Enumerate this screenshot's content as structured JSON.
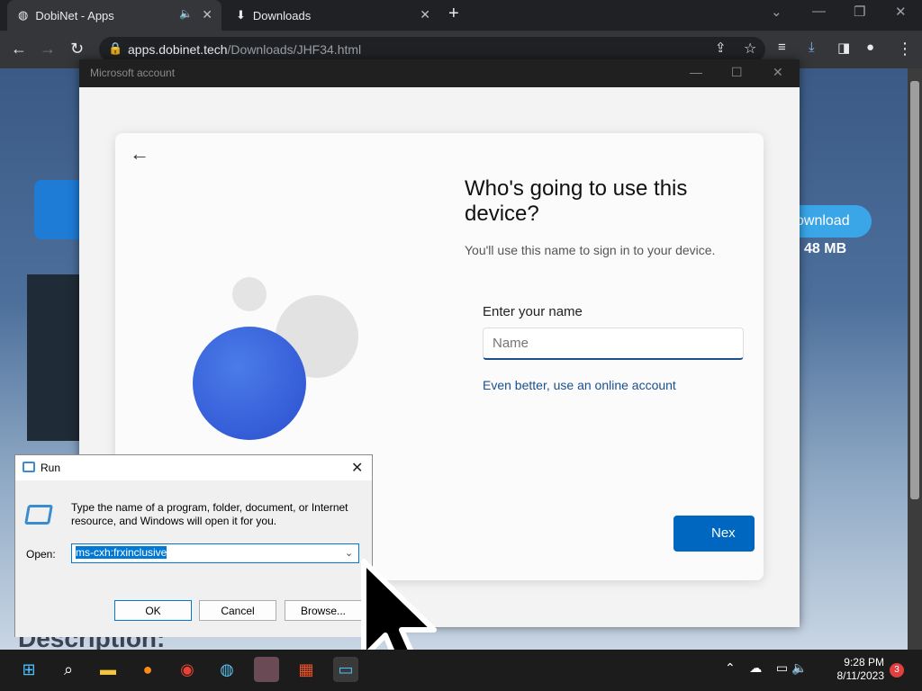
{
  "browser": {
    "tabs": [
      {
        "title": "DobiNet - Apps"
      },
      {
        "title": "Downloads"
      }
    ],
    "url_host": "apps.dobinet.tech",
    "url_path": "/Downloads/JHF34.html"
  },
  "page": {
    "download_label": "ownload",
    "size_label": "48 MB",
    "description": "Description:"
  },
  "msa": {
    "title": "Microsoft account",
    "heading": "Who's going to use this device?",
    "subtitle": "You'll use this name to sign in to your device.",
    "name_label": "Enter your name",
    "name_placeholder": "Name",
    "online_link": "Even better, use an online account",
    "next_label": "Nex"
  },
  "run": {
    "title": "Run",
    "description": "Type the name of a program, folder, document, or Internet resource, and Windows will open it for you.",
    "open_label": "Open:",
    "open_value": "ms-cxh:frxinclusive",
    "ok": "OK",
    "cancel": "Cancel",
    "browse": "Browse..."
  },
  "taskbar": {
    "time": "9:28 PM",
    "date": "8/11/2023",
    "notifications": "3"
  }
}
